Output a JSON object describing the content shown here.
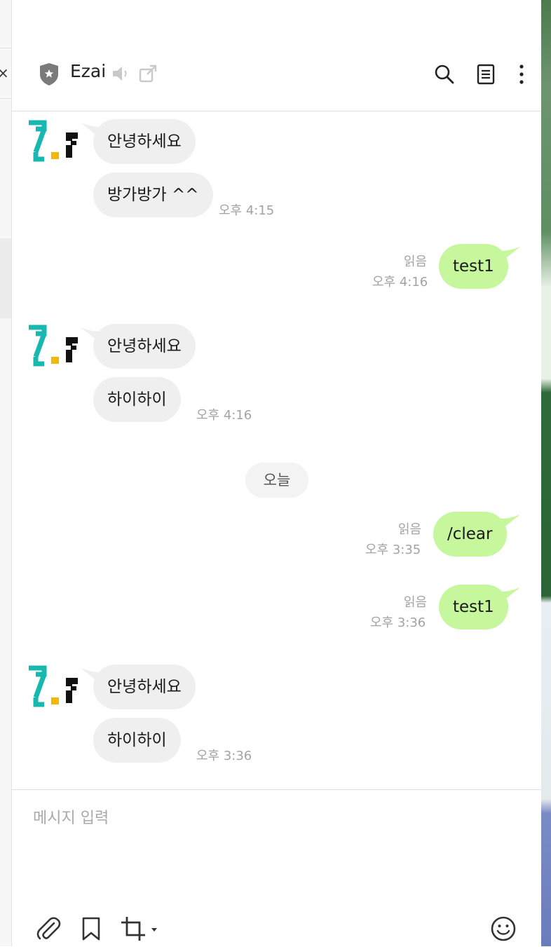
{
  "header": {
    "title": "Ezai"
  },
  "messages": {
    "m1": {
      "lines": [
        "안녕하세요",
        "방가방가 ^^"
      ],
      "time": "오후 4:15"
    },
    "m2": {
      "text": "test1",
      "read": "읽음",
      "time": "오후 4:16"
    },
    "m3": {
      "lines": [
        "안녕하세요",
        "하이하이"
      ],
      "time": "오후 4:16"
    },
    "divider": "오늘",
    "m4": {
      "text": "/clear",
      "read": "읽음",
      "time": "오후 3:35"
    },
    "m5": {
      "text": "test1",
      "read": "읽음",
      "time": "오후 3:36"
    },
    "m6": {
      "lines": [
        "안녕하세요",
        "하이하이"
      ],
      "time": "오후 3:36"
    }
  },
  "composer": {
    "placeholder": "메시지 입력"
  },
  "colors": {
    "outgoing_bubble": "#c6f79c",
    "incoming_bubble": "#efefef",
    "avatar_teal": "#16b8b0",
    "avatar_yellow": "#f5b800"
  },
  "icons": [
    "shield-icon",
    "speaker-icon",
    "popout-icon",
    "search-icon",
    "note-icon",
    "more-icon",
    "attach-icon",
    "bookmark-icon",
    "crop-icon",
    "emoji-icon"
  ]
}
